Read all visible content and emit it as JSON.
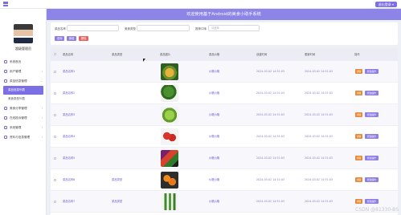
{
  "topbar": {
    "button_label": "退出登录 ▾"
  },
  "header": {
    "title": "欢迎使用基于Android的美食小助手系统"
  },
  "sidebar": {
    "username": "超级管理员",
    "items": [
      {
        "label": "系统首页",
        "arrow": ""
      },
      {
        "label": "用户管理",
        "arrow": "›"
      },
      {
        "label": "菜品信息管理",
        "arrow": "⌄"
      }
    ],
    "subitems": [
      {
        "label": "菜品信息列表",
        "active": true
      },
      {
        "label": "美食类型列表",
        "active": false
      }
    ],
    "items2": [
      {
        "label": "美食分享管理",
        "arrow": "›"
      },
      {
        "label": "在线投诉管理",
        "arrow": "›"
      },
      {
        "label": "系统管理",
        "arrow": "›"
      },
      {
        "label": "资料与信息管理",
        "arrow": "›"
      }
    ]
  },
  "filters": {
    "label1": "菜品名称",
    "label2": "美食类型",
    "label3": "推荐口味",
    "select_placeholder": "请选择",
    "buttons": [
      {
        "label": "查询",
        "color": "#8d7fe6"
      },
      {
        "label": "新增",
        "color": "#8d7fe6"
      },
      {
        "label": "删除",
        "color": "#e9625d"
      }
    ]
  },
  "table": {
    "headers": [
      "菜品名称",
      "菜品类型",
      "菜品图片",
      "菜品价格",
      "创建时间",
      "更新时间",
      "操作"
    ],
    "rows": [
      {
        "name": "菜品名称1",
        "type": "",
        "price": "价格价格",
        "created": "2024-03-02 14:51:03",
        "updated": "2024-03-02 14:51:03",
        "img": "pineapple"
      },
      {
        "name": "菜品名称2",
        "type": "",
        "price": "价格价格",
        "created": "2024-03-02 14:51:03",
        "updated": "2024-03-02 14:51:03",
        "img": "broccoli"
      },
      {
        "name": "菜品名称3",
        "type": "",
        "price": "价格价格",
        "created": "2024-03-02 14:51:03",
        "updated": "2024-03-02 14:51:03",
        "img": "lettuce"
      },
      {
        "name": "菜品名称4",
        "type": "",
        "price": "价格价格",
        "created": "2024-03-02 14:51:03",
        "updated": "2024-03-02 14:51:03",
        "img": "tomato"
      },
      {
        "name": "菜品名称5",
        "type": "",
        "price": "价格价格",
        "created": "2024-03-02 14:51:03",
        "updated": "2024-03-02 14:51:03",
        "img": "fruits"
      },
      {
        "name": "菜品名称6",
        "type": "菜品类型",
        "price": "价格价格",
        "created": "2024-03-02 14:51:03",
        "updated": "2024-03-02 14:51:03",
        "img": "oranges"
      },
      {
        "name": "菜品名称7",
        "type": "菜品类型",
        "price": "价格价格",
        "created": "2024-03-02 14:51:03",
        "updated": "2024-03-02 14:51:03",
        "img": "cucumbers"
      }
    ],
    "action_edit": "详情",
    "action_more": "修改操作"
  },
  "watermark": "CSDN @81330-BS"
}
